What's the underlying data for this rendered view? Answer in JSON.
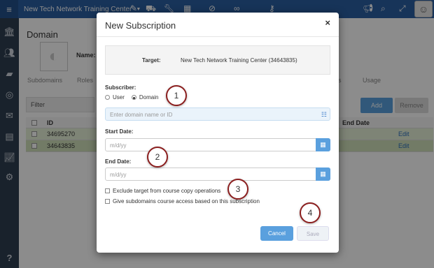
{
  "topbar": {
    "menu_icon": "hamburger-icon",
    "app_title": "New Tech Network Training Center",
    "icons": [
      "pencil-icon",
      "truck-icon",
      "wrench-icon",
      "calendar-icon",
      "tag-icon",
      "binoculars-icon",
      "key-icon",
      "megaphone-icon",
      "search-icon",
      "expand-icon",
      "avatar-icon"
    ]
  },
  "rail": {
    "icons": [
      "institution-icon",
      "users-icon",
      "book-icon",
      "target-icon",
      "envelope-icon",
      "list-icon",
      "chart-icon",
      "gears-icon",
      "help-icon"
    ],
    "help_label": "?"
  },
  "background_page": {
    "title": "Domain",
    "name_label": "Name:",
    "tabs": [
      "Subdomains",
      "Roles",
      "s",
      "Usage"
    ],
    "filter_label": "Filter",
    "add_label": "Add",
    "remove_label": "Remove",
    "columns": [
      "ID",
      "End Date"
    ],
    "rows": [
      {
        "id": "34695270",
        "action": "Edit"
      },
      {
        "id": "34643835",
        "action": "Edit"
      }
    ]
  },
  "modal": {
    "title": "New Subscription",
    "close_label": "×",
    "target_label": "Target:",
    "target_value": "New Tech Network Training Center (34643835)",
    "subscriber_label": "Subscriber:",
    "radio_user": "User",
    "radio_domain": "Domain",
    "domain_placeholder": "Enter domain name or ID",
    "start_date_label": "Start Date:",
    "start_date_placeholder": "m/d/yy",
    "end_date_label": "End Date:",
    "end_date_placeholder": "m/d/yy",
    "check_exclude": "Exclude target from course copy operations",
    "check_subdomains": "Give subdomains course access based on this subscription",
    "cancel_label": "Cancel",
    "save_label": "Save"
  },
  "callouts": [
    "1",
    "2",
    "3",
    "4"
  ],
  "colors": {
    "topbar": "#2b5fa3",
    "rail": "#2f3e50",
    "accent_button": "#5aa0de",
    "callout_border": "#8b1e1e"
  }
}
